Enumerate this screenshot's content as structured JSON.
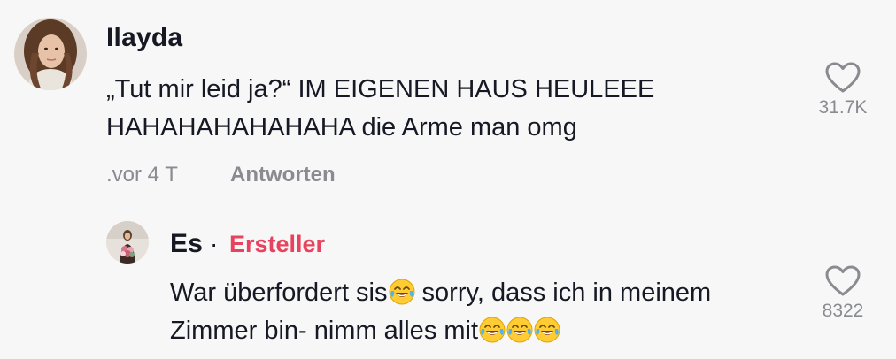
{
  "comment": {
    "username": "Ilayda",
    "text_line1": "„Tut mir leid ja?“ IM EIGENEN HAUS HEULEEE",
    "text_line2": "HAHAHAHAHAHAHA die Arme man omg",
    "time": ".vor 4 T",
    "reply_label": "Antworten",
    "like_count": "31.7K"
  },
  "reply": {
    "username": "Es",
    "separator": "·",
    "creator_label": "Ersteller",
    "text_line1_a": "War überfordert sis",
    "text_line1_b": " sorry, dass ich in meinem",
    "text_line2": "Zimmer bin- nimm alles mit",
    "like_count": "8322"
  },
  "icons": {
    "like": "heart-outline-icon",
    "emoji": "face-with-tears-of-joy-emoji"
  },
  "colors": {
    "background": "#f7f7f7",
    "text": "#161823",
    "muted": "#8a8b91",
    "creator": "#e8435e"
  }
}
